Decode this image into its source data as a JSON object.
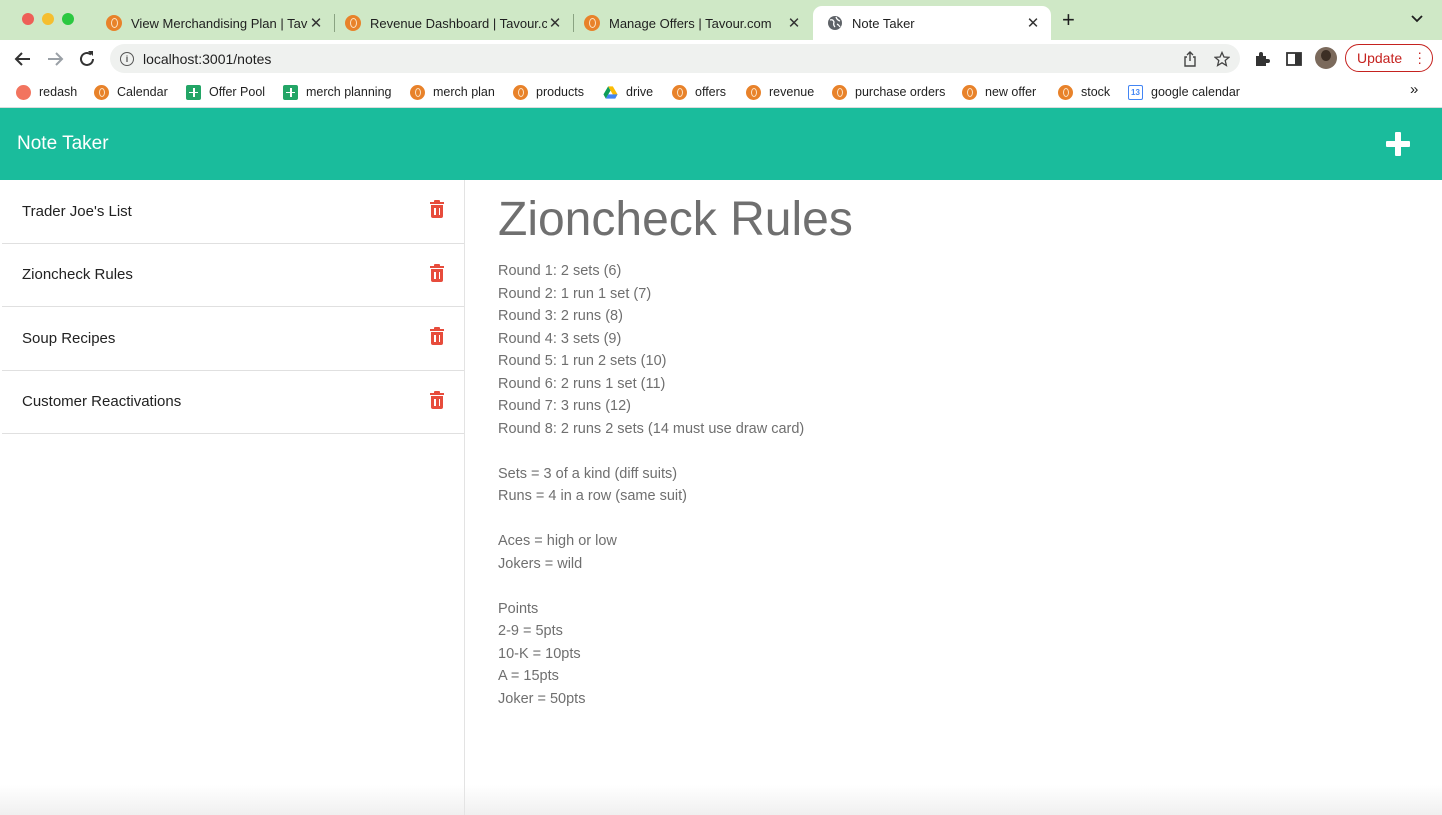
{
  "browser": {
    "tabs": [
      {
        "title": "View Merchandising Plan | Tavour.com",
        "favicon": "tavour-icon"
      },
      {
        "title": "Revenue Dashboard | Tavour.com",
        "favicon": "tavour-icon"
      },
      {
        "title": "Manage Offers | Tavour.com",
        "favicon": "tavour-icon"
      },
      {
        "title": "Note Taker",
        "favicon": "globe-icon",
        "active": true
      }
    ],
    "address": "localhost:3001/notes",
    "update_label": "Update",
    "bookmarks": [
      {
        "label": "redash",
        "icon": "redash-icon"
      },
      {
        "label": "Calendar",
        "icon": "tavour-icon"
      },
      {
        "label": "Offer Pool",
        "icon": "sheets-icon"
      },
      {
        "label": "merch planning",
        "icon": "sheets-icon"
      },
      {
        "label": "merch plan",
        "icon": "tavour-icon"
      },
      {
        "label": "products",
        "icon": "tavour-icon"
      },
      {
        "label": "drive",
        "icon": "drive-icon"
      },
      {
        "label": "offers",
        "icon": "tavour-icon"
      },
      {
        "label": "revenue",
        "icon": "tavour-icon"
      },
      {
        "label": "purchase orders",
        "icon": "tavour-icon"
      },
      {
        "label": "new offer",
        "icon": "tavour-icon"
      },
      {
        "label": "stock",
        "icon": "tavour-icon"
      },
      {
        "label": "google calendar",
        "icon": "google-calendar-icon"
      }
    ],
    "calendar_icon_day": "13",
    "more_bookmarks": "»"
  },
  "app": {
    "title": "Note Taker",
    "accent_color": "#1abc9c",
    "delete_color": "#e74c3c",
    "notes": [
      {
        "title": "Trader Joe's List"
      },
      {
        "title": "Zioncheck Rules"
      },
      {
        "title": "Soup Recipes"
      },
      {
        "title": "Customer Reactivations"
      }
    ],
    "active_note": {
      "title": "Zioncheck Rules",
      "text": "Round 1: 2 sets (6)\nRound 2: 1 run 1 set (7)\nRound 3: 2 runs (8)\nRound 4: 3 sets (9)\nRound 5: 1 run 2 sets (10)\nRound 6: 2 runs 1 set (11)\nRound 7: 3 runs (12)\nRound 8: 2 runs 2 sets (14 must use draw card)\n\nSets = 3 of a kind (diff suits)\nRuns = 4 in a row (same suit)\n\nAces = high or low\nJokers = wild\n\nPoints\n2-9 = 5pts\n10-K = 10pts\nA = 15pts\nJoker = 50pts"
    }
  }
}
